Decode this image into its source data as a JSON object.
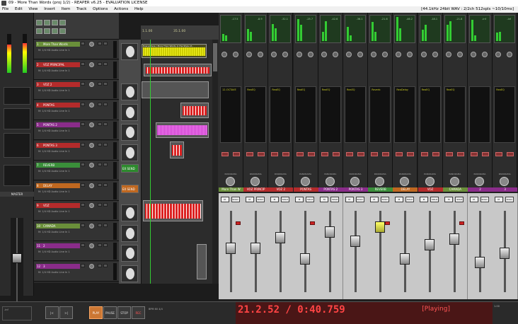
{
  "window": {
    "title": "09 - More Than Words (proj 1/2) - REAPER v6.25 - EVALUATION LICENSE"
  },
  "menu": {
    "items": [
      "File",
      "Edit",
      "View",
      "Insert",
      "Item",
      "Track",
      "Options",
      "Actions",
      "Help"
    ],
    "status": "[44.1kHz 24bit WAV : 2/2ch 512spls ~10/10ms]"
  },
  "master": {
    "label": "MASTER",
    "peak": "-inf"
  },
  "tracks": [
    {
      "num": "1",
      "name": "More Than Words",
      "color": "#6a8f3a",
      "input": "M: 1/4 HD Audio Line In 1"
    },
    {
      "num": "2",
      "name": "VOZ PRINCIPAL",
      "color": "#b42b2b",
      "input": "M: 1/4 HD Audio Line In 1"
    },
    {
      "num": "3",
      "name": "VOZ 2",
      "color": "#b42b2b",
      "input": "M: 1/4 HD Audio Line In 1"
    },
    {
      "num": "4",
      "name": "PONTAS",
      "color": "#b42b2b",
      "input": "M: 1/4 HD Audio Line In 1"
    },
    {
      "num": "5",
      "name": "PONTAS 2",
      "color": "#8a2c8a",
      "input": "M: 1/4 HD Audio Line In 1"
    },
    {
      "num": "6",
      "name": "PONTAS 3",
      "color": "#b42b2b",
      "input": "M: 1/4 HD Audio Line In 1"
    },
    {
      "num": "7",
      "name": "REVERB",
      "color": "#3a8f3a",
      "input": "M: 1/4 HD Audio Line In 1"
    },
    {
      "num": "8",
      "name": "DELAY",
      "color": "#c06820",
      "input": "M: 1/4 HD Audio Line In 1"
    },
    {
      "num": "9",
      "name": "VOZ",
      "color": "#b42b2b",
      "input": "M: 1/4 HD Audio Line In 1"
    },
    {
      "num": "10",
      "name": "CAMADA",
      "color": "#6a8f3a",
      "input": "M: 1/4 HD Audio Line In 1"
    },
    {
      "num": "11",
      "name": "2",
      "color": "#8a2c8a",
      "input": "M: 1/4 HD Audio Line In 1"
    },
    {
      "num": "12",
      "name": "3",
      "color": "#8a2c8a",
      "input": "M: 1/4 HD Audio Line In 1"
    }
  ],
  "arrange": {
    "ruler_marks": [
      "1.1.00",
      "35.1.00"
    ],
    "top_clip_label": "Everywhere / More Than Words in the Style of...",
    "ex_send_label": "EX SEND"
  },
  "mixer": {
    "strip_names": [
      "More Than W",
      "VOZ PRINCIP",
      "VOZ 2",
      "PONTAS",
      "PONTAS 2",
      "PONTAS 3",
      "REVERB",
      "DELAY",
      "VOZ",
      "CAMADA",
      "2",
      "3"
    ],
    "strip_colors": [
      "#6a8f3a",
      "#b42b2b",
      "#b42b2b",
      "#b42b2b",
      "#8a2c8a",
      "#8a2c8a",
      "#3a8f3a",
      "#c06820",
      "#b42b2b",
      "#6a8f3a",
      "#8a2c8a",
      "#8a2c8a"
    ],
    "strip_db": [
      "-17.5",
      "-8.9",
      "-32.1",
      "-25.7",
      "-42.6",
      "-36.1",
      "-21.6",
      "-46.2",
      "-18.1",
      "-21.8",
      "-inf",
      "-inf"
    ],
    "panorama": "PANORAMA",
    "solo": "SOLO",
    "mute": "M",
    "fader_levels": [
      0.55,
      0.55,
      0.7,
      0.4,
      0.78,
      0.65,
      0.85,
      0.4,
      0.6,
      0.68,
      0.35,
      0.48
    ],
    "fx_text": [
      "12-OCTAVE",
      "ReaEQ",
      "ReaEQ",
      "ReaEQ",
      "ReaEQ",
      "ReaEQ",
      "Reverb",
      "ReaDelay",
      "ReaEQ",
      "ReaEQ",
      "",
      "ReaEQ"
    ]
  },
  "transport": {
    "buttons": [
      "PLAY",
      "PAUSE",
      "STOP",
      "REC"
    ],
    "time": "21.2.52 / 0:40.759",
    "status": "[Playing]",
    "tempo": "BPM 60  4/4",
    "rate": "1.00"
  }
}
